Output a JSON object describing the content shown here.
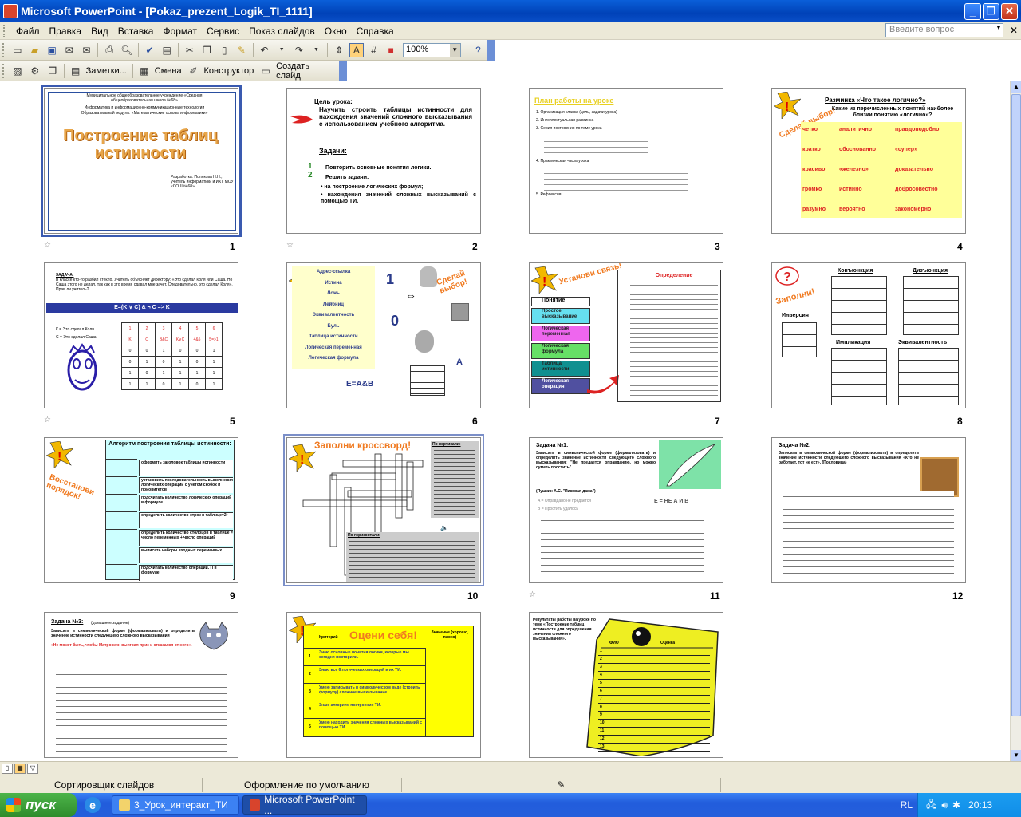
{
  "window": {
    "title": "Microsoft PowerPoint - [Pokaz_prezent_Logik_TI_1111]",
    "minimize": "_",
    "maximize": "❐",
    "close": "✕"
  },
  "menu": {
    "items": [
      "Файл",
      "Правка",
      "Вид",
      "Вставка",
      "Формат",
      "Сервис",
      "Показ слайдов",
      "Окно",
      "Справка"
    ],
    "ask_placeholder": "Введите вопрос",
    "close_doc": "✕"
  },
  "toolbar1": {
    "zoom": "100%"
  },
  "toolbar2": {
    "notes_label": "Заметки...",
    "transition_label": "Смена",
    "designer_label": "Конструктор",
    "new_slide_label": "Создать слайд"
  },
  "slides": [
    {
      "num": "1",
      "title": "Построение таблиц истинности",
      "header1": "Муниципальное общеобразовательное учреждение «Средняя общеобразовательная школа №68»",
      "header2": "Информатика и информационно-коммуникационные технологии",
      "header3": "Образовательный модуль: «Математические основы информатики»",
      "author": "Разработка: Полякова Н.Н., учитель информатики и ИКТ МОУ «СОШ №68»"
    },
    {
      "num": "2",
      "goal_label": "Цель урока:",
      "goal": "Научить строить таблицы истинности для нахождения значений сложного высказывания с использованием учебного алгоритма.",
      "tasks_label": "Задачи:",
      "task1": "Повторить основные понятия логики.",
      "task2": "Решить задачи:",
      "b1": "на построение логических формул;",
      "b2": "нахождения значений сложных высказываний с помощью ТИ."
    },
    {
      "num": "3",
      "title": "План работы на уроке",
      "items": [
        "1. Организация класса (цель, задачи урока)",
        "2. Интеллектуальная разминка",
        "3. Серия построения по теме урока",
        "4. Практическая часть урока",
        "5. Рефлексия"
      ]
    },
    {
      "num": "4",
      "title": "Разминка «Что такое логично?»",
      "question": "Какие из перечисленных понятий наиболее близки понятию «логично»?",
      "words": [
        "четко",
        "аналитично",
        "правдоподобно",
        "кратко",
        "обоснованно",
        "«супер»",
        "красиво",
        "«железно»",
        "доказательно",
        "громко",
        "истинно",
        "добросовестно",
        "разумно",
        "вероятно",
        "закономерно"
      ],
      "sticker": "Сделай выбор!"
    },
    {
      "num": "5",
      "task_label": "ЗАДАЧА:",
      "task": "В классе кто-то разбил стекло. Учитель объясняет директору: «Это сделал Коля или Саша. Но Саша этого не делал, так как в это время сдавал мне зачет. Следовательно, это сделал Коля». Прав ли учитель?",
      "formula": "E=(K ∨ C) & ¬ C => K",
      "legend1": "К = Это сделал Коля.",
      "legend2": "С = Это сделал Саша.",
      "cols": [
        "1",
        "2",
        "3",
        "4",
        "5",
        "6"
      ],
      "heads": [
        "K",
        "C",
        "B&C",
        "K∨C",
        "4&5",
        "5=>1"
      ],
      "rows": [
        [
          "0",
          "0",
          "1",
          "0",
          "0",
          "1"
        ],
        [
          "0",
          "1",
          "0",
          "1",
          "0",
          "1"
        ],
        [
          "1",
          "0",
          "1",
          "1",
          "1",
          "1"
        ],
        [
          "1",
          "1",
          "0",
          "1",
          "0",
          "1"
        ]
      ]
    },
    {
      "num": "6",
      "terms": [
        "Адрес-ссылка",
        "Истина",
        "Ложь",
        "Лейбниц",
        "Эквивалентность",
        "Буль",
        "Таблица истинности",
        "Логическая переменная",
        "Логическая формула"
      ],
      "one": "1",
      "zero": "0",
      "arrow": "⇔",
      "formula": "E=A&B",
      "letter": "A",
      "sticker": "Сделай выбор!"
    },
    {
      "num": "7",
      "header": "Понятие",
      "def_header": "Определение",
      "concepts": [
        "Простое высказывание",
        "Логическая переменная",
        "Логическая формула",
        "Таблица истинности",
        "Логическая операция"
      ],
      "sticker": "Установи связь!"
    },
    {
      "num": "8",
      "conj": "Конъюнкция",
      "disj": "Дизъюнкция",
      "inv": "Инверсия",
      "impl": "Импликация",
      "equiv": "Эквивалентность",
      "sticker": "Заполни!"
    },
    {
      "num": "9",
      "title": "Алгоритм построения таблицы истинности:",
      "steps": [
        "оформить заголовок таблицы истинности",
        "установить последовательность выполнения логических операций с учетом скобок и приоритетов",
        "подсчитать количество логических операций в формуле",
        "определить количество строк в таблице=2ⁿ",
        "определить количество столбцов в таблице = число переменных + число операций",
        "выписать наборы входных переменных",
        "подсчитать количество операций. П в формуле"
      ],
      "sticker": "Восстанови порядок!"
    },
    {
      "num": "10",
      "title": "Заполни кроссворд!",
      "down_label": "По вертикали:",
      "across_label": "По горизонтали:"
    },
    {
      "num": "11",
      "task_label": "Задача №1:",
      "task": "Записать в символической форме (формализовать) и определить значение истинности следующего сложного высказывания: \"Не предается оправданию, но можно суметь простить\".",
      "source": "(Пушкин А.С. \"Пиковая дама\")",
      "a": "A = Оправдано не предается",
      "b": "B = Простить удалось",
      "formula": "E = НЕ А И B"
    },
    {
      "num": "12",
      "task_label": "Задача №2:",
      "task": "Записать в символической форме (формализовать) и определить значение истинности следующего сложного высказывания «Кто не работает, тот не ест». (Пословица)"
    },
    {
      "num": "",
      "task_label": "Задача №3:",
      "note": "(домашнее задание)",
      "task": "Записать в символической форме (формализовать) и определить значение истинности следующего сложного высказывания",
      "quote": "«Не может быть, чтобы Матроскин выиграл приз и отказался от него»."
    },
    {
      "num": "",
      "title": "Оцени себя!",
      "col1": "Критерий",
      "col2": "Значение (хорошо, плохо)",
      "criteria": [
        "Знаю основные понятия логики, которые мы сегодня повторили.",
        "Знаю все 6 логических операций и их ТИ.",
        "Умею записывать в символическом виде (строить формулу) сложное высказывание.",
        "Знаю алгоритм построения ТИ.",
        "Умею находить значения сложных высказываний с помощью ТИ."
      ],
      "nums": [
        "1",
        "2",
        "3",
        "4",
        "5"
      ]
    },
    {
      "num": "",
      "text": "Результаты работы на уроке по теме «Построение таблиц истинности для определения значения сложного высказывания».",
      "col_a": "ФИО",
      "col_b": "Оценка",
      "rows": [
        "1",
        "2",
        "3",
        "4",
        "5",
        "6",
        "7",
        "8",
        "9",
        "10",
        "11",
        "12",
        "13"
      ]
    }
  ],
  "statusbar": {
    "view": "Сортировщик слайдов",
    "design": "Оформление по умолчанию"
  },
  "taskbar": {
    "start": "пуск",
    "task1": "3_Урок_интеракт_ТИ",
    "task2": "Microsoft PowerPoint ...",
    "lang": "RL",
    "time": "20:13"
  }
}
